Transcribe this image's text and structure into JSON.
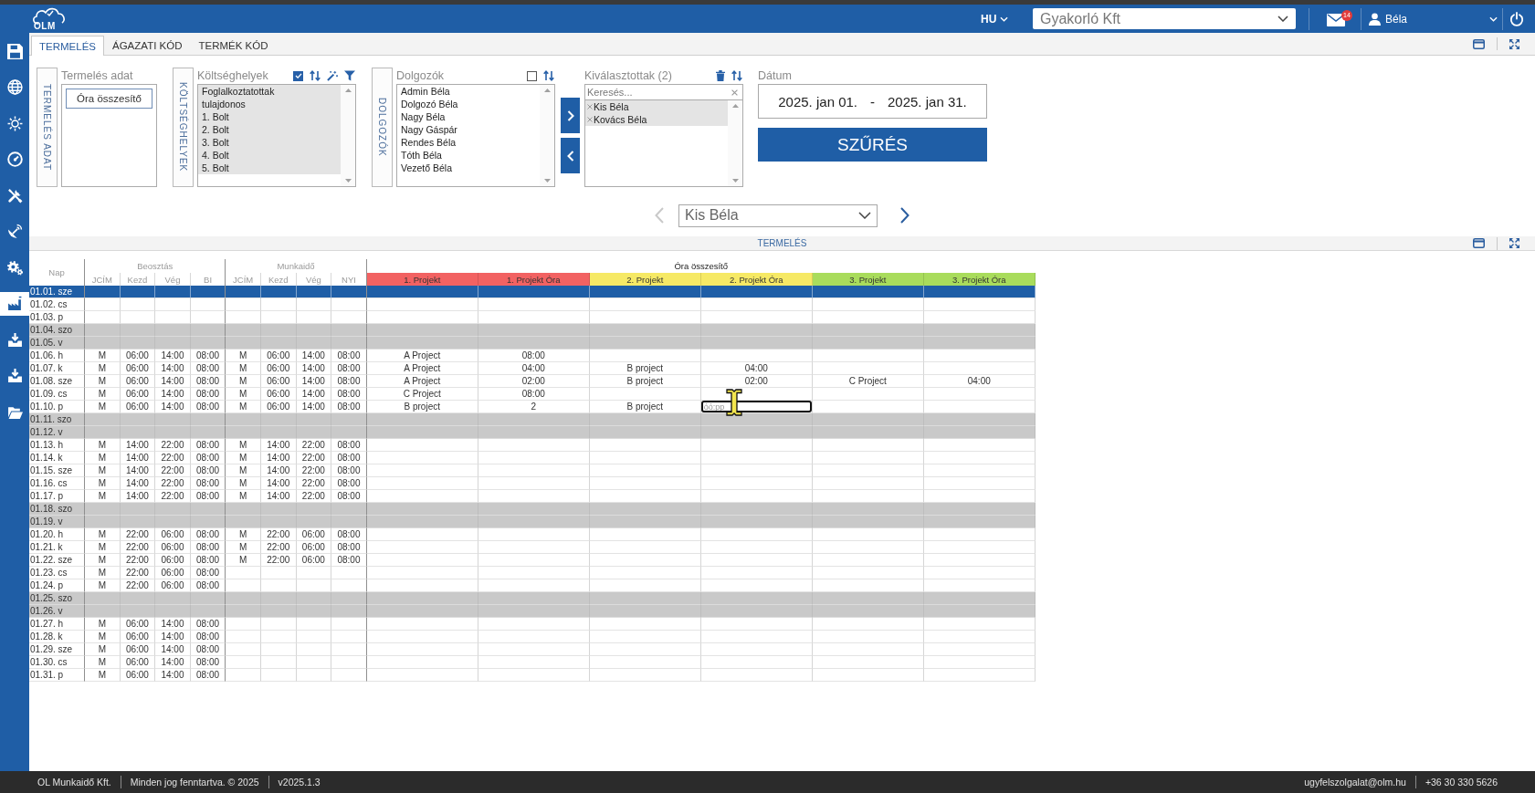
{
  "header": {
    "logo": "OLM",
    "language": "HU",
    "company": "Gyakorló Kft",
    "unread_messages": "14",
    "user": "Béla"
  },
  "sidebar": {
    "items": [
      {
        "selected": false
      },
      {
        "selected": false
      },
      {
        "selected": false
      },
      {
        "selected": false
      },
      {
        "selected": false
      },
      {
        "selected": false
      },
      {
        "selected": false
      },
      {
        "selected": true
      },
      {
        "selected": false
      },
      {
        "selected": false
      },
      {
        "selected": false
      }
    ]
  },
  "tabs": [
    {
      "label": "TERMELÉS",
      "selected": true
    },
    {
      "label": "ÁGAZATI KÓD",
      "selected": false
    },
    {
      "label": "TERMÉK KÓD",
      "selected": false
    }
  ],
  "filters": {
    "production_data": {
      "side_label": "TERMELÉS ADAT",
      "label": "Termelés adat",
      "items": [
        {
          "label": "Óra összesítő"
        }
      ]
    },
    "cost_centers": {
      "side_label": "KÖLTSÉGHELYEK",
      "label": "Költséghelyek",
      "all_checked": true,
      "items": [
        {
          "label": "Foglalkoztatottak",
          "selected": true
        },
        {
          "label": "tulajdonos",
          "selected": true
        },
        {
          "label": "1. Bolt",
          "selected": true
        },
        {
          "label": "2. Bolt",
          "selected": true
        },
        {
          "label": "3. Bolt",
          "selected": true
        },
        {
          "label": "4. Bolt",
          "selected": true
        },
        {
          "label": "5. Bolt",
          "selected": true
        }
      ]
    },
    "employees": {
      "side_label": "DOLGOZÓK",
      "label": "Dolgozók",
      "all_checked": false,
      "items": [
        {
          "label": "Admin Béla",
          "selected": false
        },
        {
          "label": "Dolgozó Béla",
          "selected": false
        },
        {
          "label": "Nagy Béla",
          "selected": false
        },
        {
          "label": "Nagy Gáspár",
          "selected": false
        },
        {
          "label": "Rendes Béla",
          "selected": false
        },
        {
          "label": "Tóth Béla",
          "selected": false
        },
        {
          "label": "Vezető Béla",
          "selected": false
        }
      ]
    },
    "chosen": {
      "label": "Kiválasztottak (2)",
      "search": {
        "placeholder": "Keresés..."
      },
      "items": [
        {
          "label": "Kis Béla"
        },
        {
          "label": "Kovács Béla"
        }
      ]
    },
    "date": {
      "label": "Dátum",
      "from": "2025. jan 01.",
      "separator": "-",
      "to": "2025. jan 31."
    },
    "filter_button": "SZŰRÉS"
  },
  "employee_nav": {
    "value": "Kis Béla",
    "previous_disabled": true,
    "next_disabled": false
  },
  "section_title": "TERMELÉS",
  "table": {
    "day_column": "Nap",
    "groups": [
      {
        "label": "Beosztás",
        "columns": [
          {
            "label": "JCÍM"
          },
          {
            "label": "Kezd"
          },
          {
            "label": "Vég"
          },
          {
            "label": "BI"
          }
        ]
      },
      {
        "label": "Munkaidő",
        "columns": [
          {
            "label": "JCÍM"
          },
          {
            "label": "Kezd"
          },
          {
            "label": "Vég"
          },
          {
            "label": "NYI"
          }
        ]
      },
      {
        "label": "Óra összesítő",
        "columns": [
          {
            "label": "1. Projekt",
            "color": "#f26262"
          },
          {
            "label": "1. Projekt Óra",
            "color": "#f26262"
          },
          {
            "label": "2. Projekt",
            "color": "#f6e965"
          },
          {
            "label": "2. Projekt Óra",
            "color": "#f6e965"
          },
          {
            "label": "3. Projekt",
            "color": "#a9dc5c"
          },
          {
            "label": "3. Projekt Óra",
            "color": "#a9dc5c"
          }
        ]
      }
    ],
    "rows": [
      {
        "day": "01.01. sze",
        "kind": "workday",
        "selected": true
      },
      {
        "day": "01.02. cs",
        "kind": "workday",
        "selected": false
      },
      {
        "day": "01.03. p",
        "kind": "workday",
        "selected": false
      },
      {
        "day": "01.04. szo",
        "kind": "weekend",
        "selected": false
      },
      {
        "day": "01.05. v",
        "kind": "weekend",
        "selected": false
      },
      {
        "day": "01.06. h",
        "kind": "workday",
        "selected": false,
        "values": [
          [
            "M",
            "06:00",
            "14:00",
            "08:00"
          ],
          [
            "M",
            "06:00",
            "14:00",
            "08:00"
          ],
          [
            "A Project",
            "08:00"
          ]
        ]
      },
      {
        "day": "01.07. k",
        "kind": "workday",
        "selected": false,
        "values": [
          [
            "M",
            "06:00",
            "14:00",
            "08:00"
          ],
          [
            "M",
            "06:00",
            "14:00",
            "08:00"
          ],
          [
            "A Project",
            "04:00",
            "B project",
            "04:00"
          ]
        ]
      },
      {
        "day": "01.08. sze",
        "kind": "workday",
        "selected": false,
        "values": [
          [
            "M",
            "06:00",
            "14:00",
            "08:00"
          ],
          [
            "M",
            "06:00",
            "14:00",
            "08:00"
          ],
          [
            "A Project",
            "02:00",
            "B project",
            "02:00",
            "C Project",
            "04:00"
          ]
        ]
      },
      {
        "day": "01.09. cs",
        "kind": "workday",
        "selected": false,
        "values": [
          [
            "M",
            "06:00",
            "14:00",
            "08:00"
          ],
          [
            "M",
            "06:00",
            "14:00",
            "08:00"
          ],
          [
            "C Project",
            "08:00"
          ]
        ]
      },
      {
        "day": "01.10. p",
        "kind": "workday",
        "selected": false,
        "values": [
          [
            "M",
            "06:00",
            "14:00",
            "08:00"
          ],
          [
            "M",
            "06:00",
            "14:00",
            "08:00"
          ],
          [
            "B project",
            "2",
            "B project",
            {
              "kind": "input",
              "placeholder": "óó:pp"
            }
          ]
        ]
      },
      {
        "day": "01.11. szo",
        "kind": "weekend",
        "selected": false
      },
      {
        "day": "01.12. v",
        "kind": "weekend",
        "selected": false
      },
      {
        "day": "01.13. h",
        "kind": "workday",
        "selected": false,
        "values": [
          [
            "M",
            "14:00",
            "22:00",
            "08:00"
          ],
          [
            "M",
            "14:00",
            "22:00",
            "08:00"
          ]
        ]
      },
      {
        "day": "01.14. k",
        "kind": "workday",
        "selected": false,
        "values": [
          [
            "M",
            "14:00",
            "22:00",
            "08:00"
          ],
          [
            "M",
            "14:00",
            "22:00",
            "08:00"
          ]
        ]
      },
      {
        "day": "01.15. sze",
        "kind": "workday",
        "selected": false,
        "values": [
          [
            "M",
            "14:00",
            "22:00",
            "08:00"
          ],
          [
            "M",
            "14:00",
            "22:00",
            "08:00"
          ]
        ]
      },
      {
        "day": "01.16. cs",
        "kind": "workday",
        "selected": false,
        "values": [
          [
            "M",
            "14:00",
            "22:00",
            "08:00"
          ],
          [
            "M",
            "14:00",
            "22:00",
            "08:00"
          ]
        ]
      },
      {
        "day": "01.17. p",
        "kind": "workday",
        "selected": false,
        "values": [
          [
            "M",
            "14:00",
            "22:00",
            "08:00"
          ],
          [
            "M",
            "14:00",
            "22:00",
            "08:00"
          ]
        ]
      },
      {
        "day": "01.18. szo",
        "kind": "weekend",
        "selected": false
      },
      {
        "day": "01.19. v",
        "kind": "weekend",
        "selected": false
      },
      {
        "day": "01.20. h",
        "kind": "workday",
        "selected": false,
        "values": [
          [
            "M",
            "22:00",
            "06:00",
            "08:00"
          ],
          [
            "M",
            "22:00",
            "06:00",
            "08:00"
          ]
        ]
      },
      {
        "day": "01.21. k",
        "kind": "workday",
        "selected": false,
        "values": [
          [
            "M",
            "22:00",
            "06:00",
            "08:00"
          ],
          [
            "M",
            "22:00",
            "06:00",
            "08:00"
          ]
        ]
      },
      {
        "day": "01.22. sze",
        "kind": "workday",
        "selected": false,
        "values": [
          [
            "M",
            "22:00",
            "06:00",
            "08:00"
          ],
          [
            "M",
            "22:00",
            "06:00",
            "08:00"
          ]
        ]
      },
      {
        "day": "01.23. cs",
        "kind": "workday",
        "selected": false,
        "values": [
          [
            "M",
            "22:00",
            "06:00",
            "08:00"
          ]
        ]
      },
      {
        "day": "01.24. p",
        "kind": "workday",
        "selected": false,
        "values": [
          [
            "M",
            "22:00",
            "06:00",
            "08:00"
          ]
        ]
      },
      {
        "day": "01.25. szo",
        "kind": "weekend",
        "selected": false
      },
      {
        "day": "01.26. v",
        "kind": "weekend",
        "selected": false
      },
      {
        "day": "01.27. h",
        "kind": "workday",
        "selected": false,
        "values": [
          [
            "M",
            "06:00",
            "14:00",
            "08:00"
          ]
        ]
      },
      {
        "day": "01.28. k",
        "kind": "workday",
        "selected": false,
        "values": [
          [
            "M",
            "06:00",
            "14:00",
            "08:00"
          ]
        ]
      },
      {
        "day": "01.29. sze",
        "kind": "workday",
        "selected": false,
        "values": [
          [
            "M",
            "06:00",
            "14:00",
            "08:00"
          ]
        ]
      },
      {
        "day": "01.30. cs",
        "kind": "workday",
        "selected": false,
        "values": [
          [
            "M",
            "06:00",
            "14:00",
            "08:00"
          ]
        ]
      },
      {
        "day": "01.31. p",
        "kind": "workday",
        "selected": false,
        "values": [
          [
            "M",
            "06:00",
            "14:00",
            "08:00"
          ]
        ]
      }
    ]
  },
  "footer": {
    "left": [
      "OL Munkaidő Kft.",
      "Minden jog fenntartva. © 2025",
      "v2025.1.3"
    ],
    "email": "ugyfelszolgalat@olm.hu",
    "phone": "+36 30 330 5626"
  }
}
